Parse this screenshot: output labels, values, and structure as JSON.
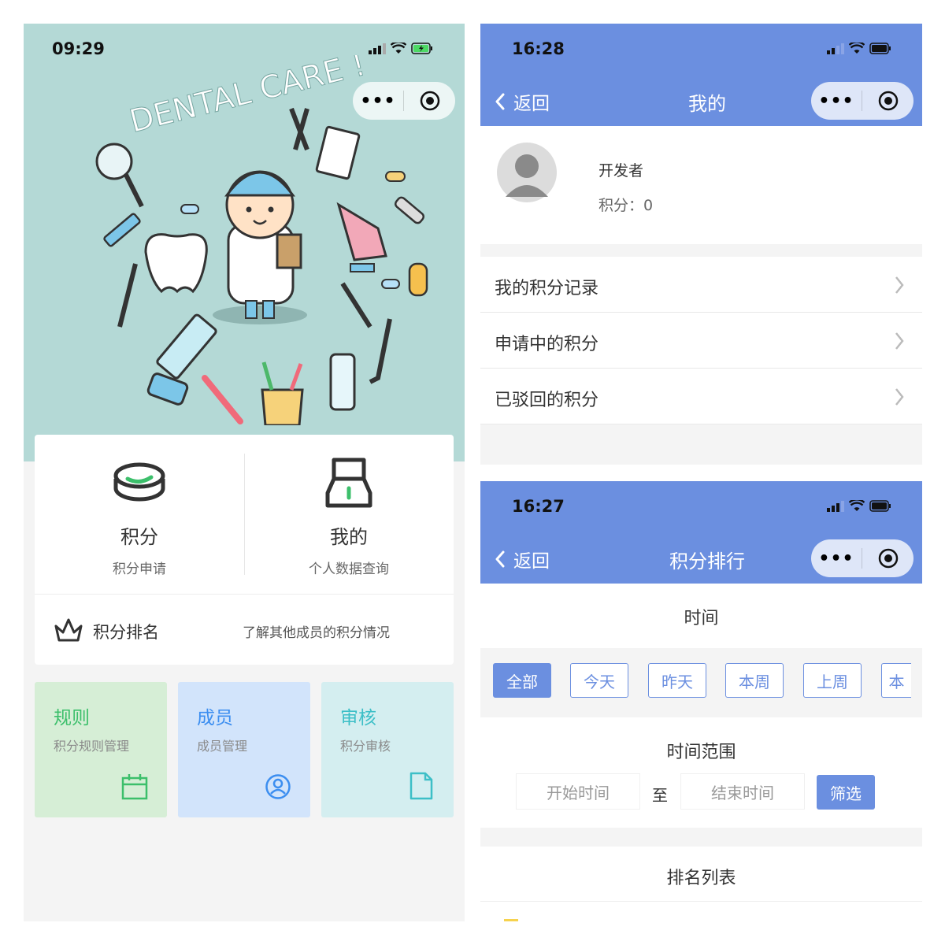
{
  "home": {
    "status_time": "09:29",
    "hero_text": "DENTAL CARE !",
    "features": [
      {
        "title": "积分",
        "subtitle": "积分申请",
        "icon": "coin-stack-icon"
      },
      {
        "title": "我的",
        "subtitle": "个人数据查询",
        "icon": "user-profile-icon"
      }
    ],
    "ranking": {
      "title": "积分排名",
      "desc": "了解其他成员的积分情况",
      "icon": "crown-icon"
    },
    "tiles": [
      {
        "title": "规则",
        "subtitle": "积分规则管理",
        "icon": "calendar-icon",
        "bg": "#d6eed6",
        "fg": "#3cbf6b"
      },
      {
        "title": "成员",
        "subtitle": "成员管理",
        "icon": "user-circle-icon",
        "bg": "#d2e4fb",
        "fg": "#3c8ef0"
      },
      {
        "title": "审核",
        "subtitle": "积分审核",
        "icon": "document-icon",
        "bg": "#d4eef0",
        "fg": "#3dbfc7"
      }
    ]
  },
  "mine": {
    "status_time": "16:28",
    "back_label": "返回",
    "title": "我的",
    "user_name": "开发者",
    "points_text": "积分：0",
    "menu": [
      "我的积分记录",
      "申请中的积分",
      "已驳回的积分"
    ]
  },
  "ranking_page": {
    "status_time": "16:27",
    "back_label": "返回",
    "title": "积分排行",
    "time_label": "时间",
    "filters": [
      "全部",
      "今天",
      "昨天",
      "本周",
      "上周",
      "本"
    ],
    "active_filter": "全部",
    "range_label": "时间范围",
    "start_placeholder": "开始时间",
    "to_label": "至",
    "end_placeholder": "结束时间",
    "filter_button": "筛选",
    "list_title": "排名列表"
  },
  "colors": {
    "accent": "#6b8fe0",
    "hero_bg": "#b4d9d6"
  }
}
